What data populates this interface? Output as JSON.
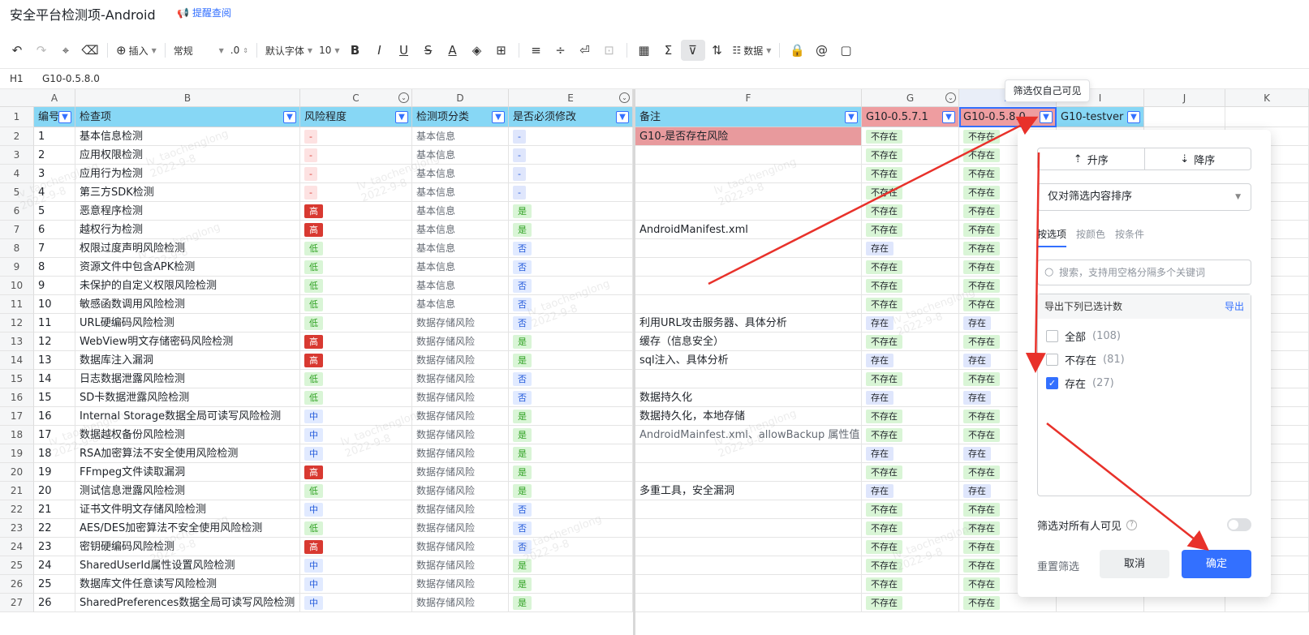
{
  "title": "安全平台检测项-Android",
  "remind": "提醒查阅",
  "toolbar": {
    "insert": "插入",
    "format": "常规",
    "decimal": ".0",
    "font": "默认字体",
    "size": "10",
    "data": "数据"
  },
  "formula_bar": {
    "cell": "H1",
    "value": "G10-0.5.8.0"
  },
  "col_letters": [
    "A",
    "B",
    "C",
    "D",
    "E",
    "F",
    "G",
    "H",
    "I",
    "J",
    "K"
  ],
  "headers": {
    "a": "编号",
    "b": "检查项",
    "c": "风险程度",
    "d": "检测项分类",
    "e": "是否必须修改",
    "f": "备注",
    "g": "G10-0.5.7.1",
    "h": "G10-0.5.8.0",
    "i": "G10-testver"
  },
  "rows": [
    {
      "n": "1",
      "name": "基本信息检测",
      "risk": "-",
      "cat": "基本信息",
      "must": "-",
      "note": "G10-是否存在风险",
      "g": "不存在",
      "h": "不存在"
    },
    {
      "n": "2",
      "name": "应用权限检测",
      "risk": "-",
      "cat": "基本信息",
      "must": "-",
      "note": "",
      "g": "不存在",
      "h": "不存在"
    },
    {
      "n": "3",
      "name": "应用行为检测",
      "risk": "-",
      "cat": "基本信息",
      "must": "-",
      "note": "",
      "g": "不存在",
      "h": "不存在"
    },
    {
      "n": "4",
      "name": "第三方SDK检测",
      "risk": "-",
      "cat": "基本信息",
      "must": "-",
      "note": "",
      "g": "不存在",
      "h": "不存在"
    },
    {
      "n": "5",
      "name": "恶意程序检测",
      "risk": "高",
      "cat": "基本信息",
      "must": "是",
      "note": "",
      "g": "不存在",
      "h": "不存在"
    },
    {
      "n": "6",
      "name": " 越权行为检测",
      "risk": "高",
      "cat": "基本信息",
      "must": "是",
      "note": "AndroidManifest.xml",
      "g": "不存在",
      "h": "不存在"
    },
    {
      "n": "7",
      "name": "权限过度声明风险检测",
      "risk": "低",
      "cat": "基本信息",
      "must": "否",
      "note": "",
      "g": "存在",
      "h": "不存在"
    },
    {
      "n": "8",
      "name": "资源文件中包含APK检测",
      "risk": "低",
      "cat": "基本信息",
      "must": "否",
      "note": "",
      "g": "不存在",
      "h": "不存在"
    },
    {
      "n": "9",
      "name": "未保护的自定义权限风险检测",
      "risk": "低",
      "cat": "基本信息",
      "must": "否",
      "note": "",
      "g": "不存在",
      "h": "不存在"
    },
    {
      "n": "10",
      "name": "敏感函数调用风险检测",
      "risk": "低",
      "cat": "基本信息",
      "must": "否",
      "note": "",
      "g": "不存在",
      "h": "不存在"
    },
    {
      "n": "11",
      "name": "URL硬编码风险检测",
      "risk": "低",
      "cat": "数据存储风险",
      "must": "否",
      "note": "利用URL攻击服务器、具体分析",
      "g": "存在",
      "h": "存在"
    },
    {
      "n": "12",
      "name": "WebView明文存储密码风险检测",
      "risk": "高",
      "cat": "数据存储风险",
      "must": "是",
      "note": "缓存（信息安全）",
      "g": "不存在",
      "h": "不存在"
    },
    {
      "n": "13",
      "name": "数据库注入漏洞",
      "risk": "高",
      "cat": "数据存储风险",
      "must": "是",
      "note": "sql注入、具体分析",
      "g": "存在",
      "h": "存在"
    },
    {
      "n": "14",
      "name": "日志数据泄露风险检测",
      "risk": "低",
      "cat": "数据存储风险",
      "must": "否",
      "note": "",
      "g": "不存在",
      "h": "不存在"
    },
    {
      "n": "15",
      "name": "SD卡数据泄露风险检测",
      "risk": "低",
      "cat": "数据存储风险",
      "must": "否",
      "note": "数据持久化",
      "g": "存在",
      "h": "存在"
    },
    {
      "n": "16",
      "name": "Internal Storage数据全局可读写风险检测",
      "risk": "中",
      "cat": "数据存储风险",
      "must": "是",
      "note": "数据持久化，本地存储",
      "g": "不存在",
      "h": "不存在"
    },
    {
      "n": "17",
      "name": "数据越权备份风险检测",
      "risk": "中",
      "cat": "数据存储风险",
      "must": "是",
      "note": "AndroidMainfest.xml、allowBackup 属性值",
      "g": "不存在",
      "h": "不存在"
    },
    {
      "n": "18",
      "name": "RSA加密算法不安全使用风险检测",
      "risk": "中",
      "cat": "数据存储风险",
      "must": "是",
      "note": "",
      "g": "存在",
      "h": "存在"
    },
    {
      "n": "19",
      "name": "FFmpeg文件读取漏洞",
      "risk": "高",
      "cat": "数据存储风险",
      "must": "是",
      "note": "",
      "g": "不存在",
      "h": "不存在"
    },
    {
      "n": "20",
      "name": "测试信息泄露风险检测",
      "risk": "低",
      "cat": "数据存储风险",
      "must": "是",
      "note": "多重工具，安全漏洞",
      "g": "存在",
      "h": "存在"
    },
    {
      "n": "21",
      "name": "证书文件明文存储风险检测",
      "risk": "中",
      "cat": "数据存储风险",
      "must": "否",
      "note": "",
      "g": "不存在",
      "h": "不存在"
    },
    {
      "n": "22",
      "name": "AES/DES加密算法不安全使用风险检测",
      "risk": "低",
      "cat": "数据存储风险",
      "must": "否",
      "note": "",
      "g": "不存在",
      "h": "不存在"
    },
    {
      "n": "23",
      "name": "密钥硬编码风险检测",
      "risk": "高",
      "cat": "数据存储风险",
      "must": "否",
      "note": "",
      "g": "不存在",
      "h": "不存在"
    },
    {
      "n": "24",
      "name": "SharedUserId属性设置风险检测",
      "risk": "中",
      "cat": "数据存储风险",
      "must": "是",
      "note": "",
      "g": "不存在",
      "h": "不存在"
    },
    {
      "n": "25",
      "name": "数据库文件任意读写风险检测",
      "risk": "中",
      "cat": "数据存储风险",
      "must": "是",
      "note": "",
      "g": "不存在",
      "h": "不存在"
    },
    {
      "n": "26",
      "name": "SharedPreferences数据全局可读写风险检测",
      "risk": "中",
      "cat": "数据存储风险",
      "must": "是",
      "note": "",
      "g": "不存在",
      "h": "不存在"
    }
  ],
  "watermark": {
    "user": "lv_taochenglong",
    "date": "2022-9-8"
  },
  "tooltip": "筛选仅自己可见",
  "filter_panel": {
    "asc": "升序",
    "desc": "降序",
    "scope": "仅对筛选内容排序",
    "tabs": [
      "按选项",
      "按颜色",
      "按条件"
    ],
    "search_placeholder": "搜索，支持用空格分隔多个关键词",
    "list_header": "导出下列已选计数",
    "export": "导出",
    "options": [
      {
        "label": "全部",
        "count": "(108)",
        "checked": false
      },
      {
        "label": "不存在",
        "count": "(81)",
        "checked": false
      },
      {
        "label": "存在",
        "count": "(27)",
        "checked": true
      }
    ],
    "visible_all": "筛选对所有人可见",
    "reset": "重置筛选",
    "cancel": "取消",
    "ok": "确定"
  }
}
